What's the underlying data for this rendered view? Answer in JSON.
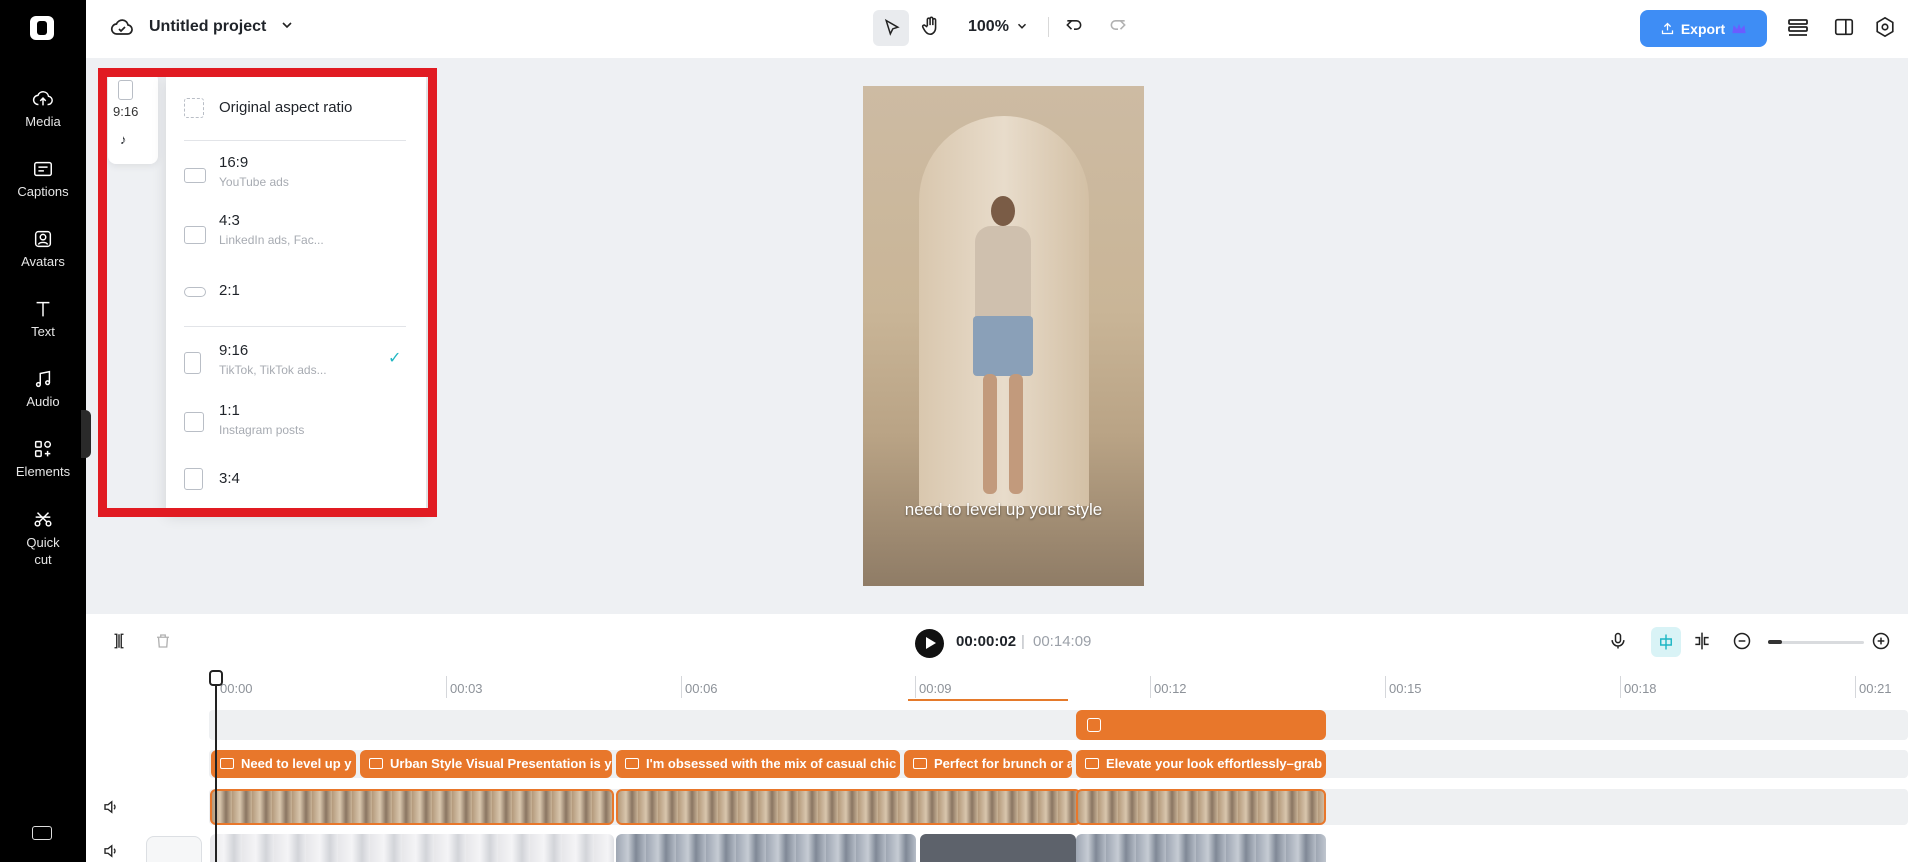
{
  "sidebar": {
    "items": [
      {
        "label": "Media",
        "icon": "cloud-upload-icon"
      },
      {
        "label": "Captions",
        "icon": "captions-icon"
      },
      {
        "label": "Avatars",
        "icon": "avatar-icon"
      },
      {
        "label": "Text",
        "icon": "text-icon"
      },
      {
        "label": "Audio",
        "icon": "music-icon"
      },
      {
        "label": "Elements",
        "icon": "elements-icon"
      },
      {
        "label": "Quick cut",
        "icon": "scissors-icon"
      }
    ]
  },
  "header": {
    "project_title": "Untitled project",
    "zoom": "100%",
    "export_label": "Export"
  },
  "preview": {
    "caption": "need to level up your style"
  },
  "ratio_strip": {
    "selected_label": "9:16"
  },
  "ratio_menu": {
    "items": [
      {
        "title": "Original aspect ratio",
        "sub": ""
      },
      {
        "title": "16:9",
        "sub": "YouTube ads"
      },
      {
        "title": "4:3",
        "sub": "LinkedIn ads, Fac..."
      },
      {
        "title": "2:1",
        "sub": ""
      },
      {
        "title": "9:16",
        "sub": "TikTok, TikTok ads..."
      },
      {
        "title": "1:1",
        "sub": "Instagram posts"
      },
      {
        "title": "3:4",
        "sub": ""
      }
    ],
    "selected": "9:16"
  },
  "playback": {
    "current_time": "00:00:02",
    "separator": "|",
    "total_time": "00:14:09"
  },
  "timeline": {
    "ruler": [
      "00:00",
      "00:03",
      "00:06",
      "00:09",
      "00:12",
      "00:15",
      "00:18",
      "00:21"
    ],
    "caption_clips": [
      "Need to level up y",
      "Urban Style Visual Presentation is y",
      "I'm obsessed with the mix of casual chic",
      "Perfect for brunch or a",
      "Elevate your look effortlessly–grab"
    ]
  },
  "colors": {
    "accent": "#3e8df5",
    "clip": "#e8772b",
    "highlight": "#e11b22",
    "check": "#22b7c3"
  }
}
